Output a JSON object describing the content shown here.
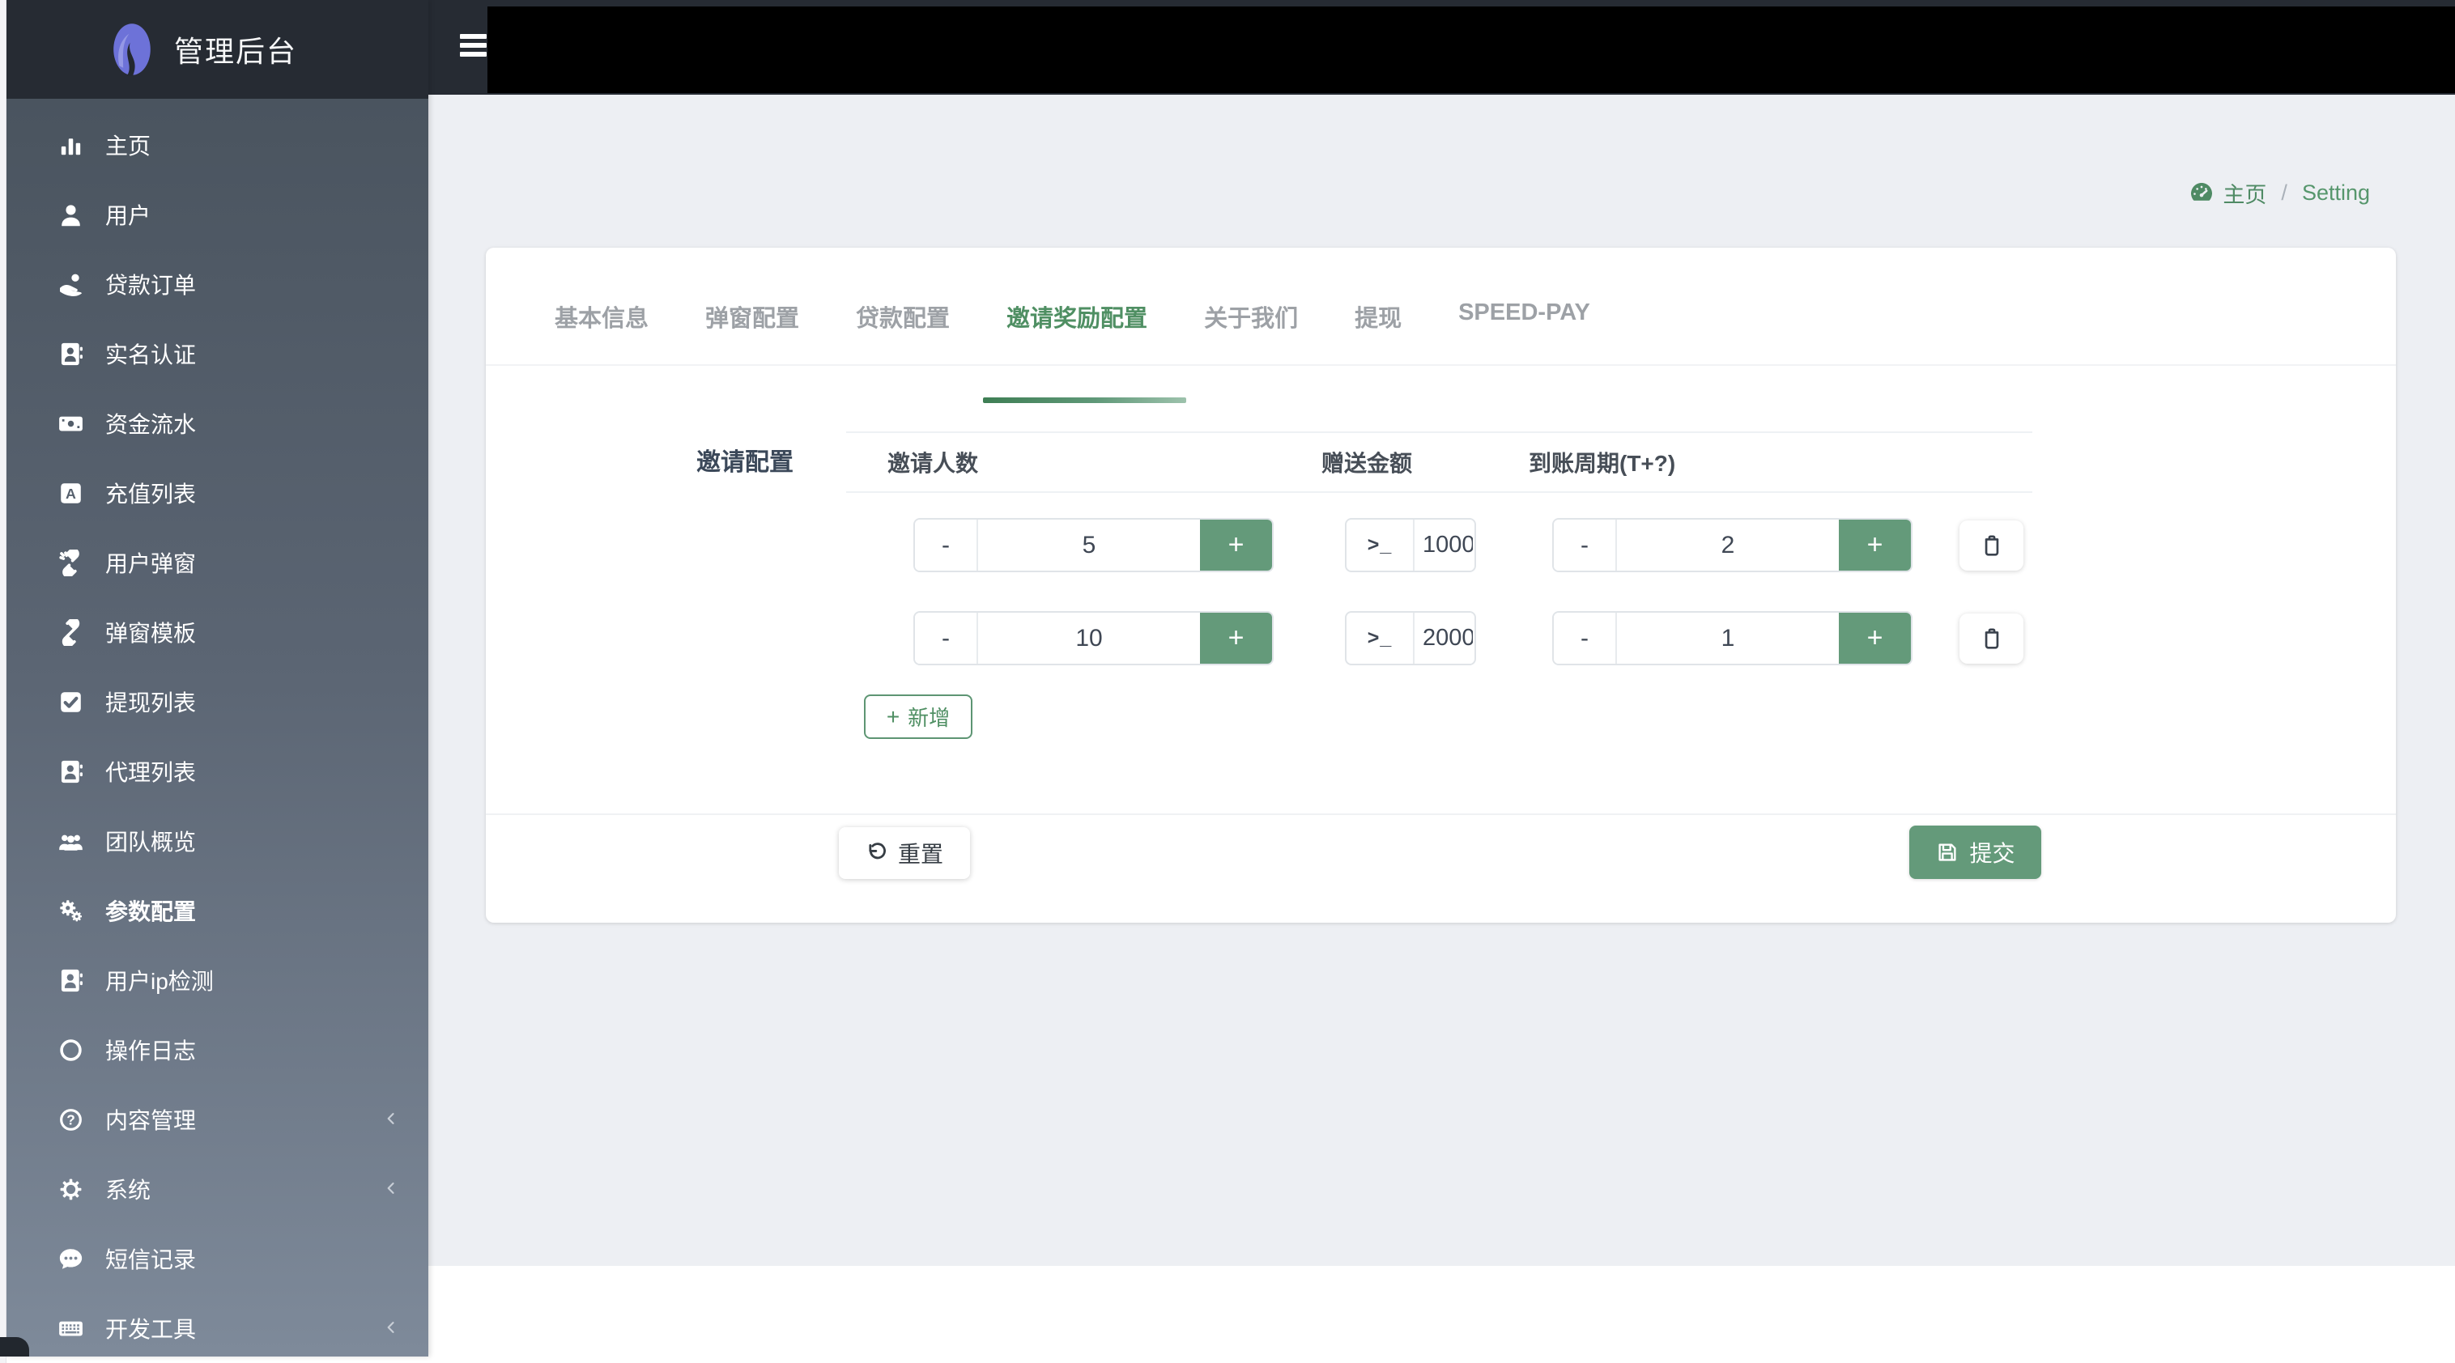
{
  "app": {
    "title": "管理后台"
  },
  "breadcrumb": {
    "home": "主页",
    "separator": "/",
    "current": "Setting"
  },
  "sidebar": {
    "items": [
      {
        "label": "主页",
        "icon": "bar-chart-icon"
      },
      {
        "label": "用户",
        "icon": "user-icon"
      },
      {
        "label": "贷款订单",
        "icon": "hand-holding-money-icon"
      },
      {
        "label": "实名认证",
        "icon": "address-book-icon"
      },
      {
        "label": "资金流水",
        "icon": "money-bill-icon"
      },
      {
        "label": "充值列表",
        "icon": "a-square-icon"
      },
      {
        "label": "用户弹窗",
        "icon": "unlink-icon"
      },
      {
        "label": "弹窗模板",
        "icon": "link-icon"
      },
      {
        "label": "提现列表",
        "icon": "check-square-icon"
      },
      {
        "label": "代理列表",
        "icon": "address-book-icon"
      },
      {
        "label": "团队概览",
        "icon": "users-icon"
      },
      {
        "label": "参数配置",
        "icon": "gears-icon",
        "active": true
      },
      {
        "label": "用户ip检测",
        "icon": "address-card-icon"
      },
      {
        "label": "操作日志",
        "icon": "circle-icon"
      },
      {
        "label": "内容管理",
        "icon": "question-circle-icon",
        "collapsible": true
      },
      {
        "label": "系统",
        "icon": "gear-icon",
        "collapsible": true
      },
      {
        "label": "短信记录",
        "icon": "comment-icon"
      },
      {
        "label": "开发工具",
        "icon": "keyboard-icon",
        "collapsible": true
      }
    ]
  },
  "tabs": [
    {
      "label": "基本信息"
    },
    {
      "label": "弹窗配置"
    },
    {
      "label": "贷款配置"
    },
    {
      "label": "邀请奖励配置",
      "active": true
    },
    {
      "label": "关于我们"
    },
    {
      "label": "提现"
    },
    {
      "label": "SPEED-PAY"
    }
  ],
  "form": {
    "section_label": "邀请配置",
    "columns": {
      "invites": "邀请人数",
      "amount": "赠送金额",
      "cycle": "到账周期(T+?)"
    },
    "rows": [
      {
        "invites": "5",
        "amount": "1000",
        "cycle": "2"
      },
      {
        "invites": "10",
        "amount": "2000",
        "cycle": "1"
      }
    ],
    "stepper": {
      "minus": "-",
      "plus": "+"
    },
    "terminal_prompt": ">_",
    "add_label": "新增",
    "reset_label": "重置",
    "submit_label": "提交"
  },
  "colors": {
    "accent_green": "#649a7a",
    "tab_active_green": "#4f8f63",
    "breadcrumb_green": "#4f8a64",
    "header_dark": "#262b33",
    "page_bg": "#edeff3",
    "sidebar_gradient_top": "#4a545f",
    "sidebar_gradient_bottom": "#7e8a9a"
  }
}
